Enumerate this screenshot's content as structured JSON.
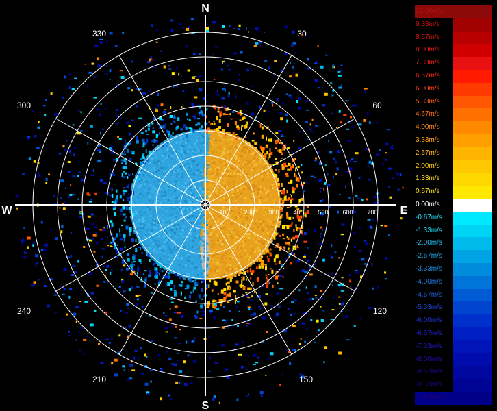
{
  "radar": {
    "cardinals": {
      "north": "N",
      "south": "S",
      "east": "E",
      "west": "W"
    },
    "bearing_labels": [
      "30",
      "60",
      "120",
      "150",
      "210",
      "240",
      "300",
      "330"
    ],
    "range_labels": [
      "100",
      "200",
      "300",
      "400",
      "500",
      "600",
      "700"
    ],
    "colors": {
      "background": "#000000",
      "grid": "#ffffff",
      "receding": "#e8a21c",
      "approaching": "#2aa6e0"
    }
  },
  "legend": {
    "entries": [
      {
        "label": "10.00m/s",
        "color": "#8c0a0a",
        "text_color": "#b01010"
      },
      {
        "label": "9.33m/s",
        "color": "#a00000",
        "text_color": "#c81010"
      },
      {
        "label": "8.67m/s",
        "color": "#b80000",
        "text_color": "#d81414"
      },
      {
        "label": "8.00m/s",
        "color": "#d00000",
        "text_color": "#e81818"
      },
      {
        "label": "7.33m/s",
        "color": "#e81010",
        "text_color": "#f02020"
      },
      {
        "label": "6.67m/s",
        "color": "#ff1a00",
        "text_color": "#ff2a10"
      },
      {
        "label": "6.00m/s",
        "color": "#ff3a00",
        "text_color": "#ff4010"
      },
      {
        "label": "5.33m/s",
        "color": "#ff5800",
        "text_color": "#ff5a18"
      },
      {
        "label": "4.67m/s",
        "color": "#ff7000",
        "text_color": "#ff7218"
      },
      {
        "label": "4.00m/s",
        "color": "#ff8a00",
        "text_color": "#ff8c18"
      },
      {
        "label": "3.33m/s",
        "color": "#ffa000",
        "text_color": "#ffa218"
      },
      {
        "label": "2.67m/s",
        "color": "#ffb400",
        "text_color": "#ffb618"
      },
      {
        "label": "2.00m/s",
        "color": "#ffc800",
        "text_color": "#ffca18"
      },
      {
        "label": "1.33m/s",
        "color": "#ffd800",
        "text_color": "#ffda18"
      },
      {
        "label": "0.67m/s",
        "color": "#ffe800",
        "text_color": "#ffe818"
      },
      {
        "label": "0.00m/s",
        "color": "#ffffff",
        "text_color": "#ffffff"
      },
      {
        "label": "-0.67m/s",
        "color": "#00e8ff",
        "text_color": "#20e8ff"
      },
      {
        "label": "-1.33m/s",
        "color": "#00d4f4",
        "text_color": "#20d4f4"
      },
      {
        "label": "-2.00m/s",
        "color": "#00bcec",
        "text_color": "#20bcec"
      },
      {
        "label": "-2.67m/s",
        "color": "#00a4e4",
        "text_color": "#20a4e4"
      },
      {
        "label": "-3.33m/s",
        "color": "#008cdc",
        "text_color": "#208cdc"
      },
      {
        "label": "-4.00m/s",
        "color": "#0074d8",
        "text_color": "#2074d8"
      },
      {
        "label": "-4.67m/s",
        "color": "#005cd4",
        "text_color": "#205cd4"
      },
      {
        "label": "-5.33m/s",
        "color": "#0044d0",
        "text_color": "#2044d0"
      },
      {
        "label": "-6.00m/s",
        "color": "#0030cc",
        "text_color": "#2030cc"
      },
      {
        "label": "-6.67m/s",
        "color": "#0020c4",
        "text_color": "#2020c4"
      },
      {
        "label": "-7.33m/s",
        "color": "#0014b8",
        "text_color": "#2014b8"
      },
      {
        "label": "-8.00m/s",
        "color": "#000cac",
        "text_color": "#200cac"
      },
      {
        "label": "-8.67m/s",
        "color": "#0008a0",
        "text_color": "#200890"
      },
      {
        "label": "-9.33m/s",
        "color": "#000494",
        "text_color": "#200480"
      },
      {
        "label": "-10.00m/s",
        "color": "#000088",
        "text_color": "#200070"
      }
    ]
  }
}
